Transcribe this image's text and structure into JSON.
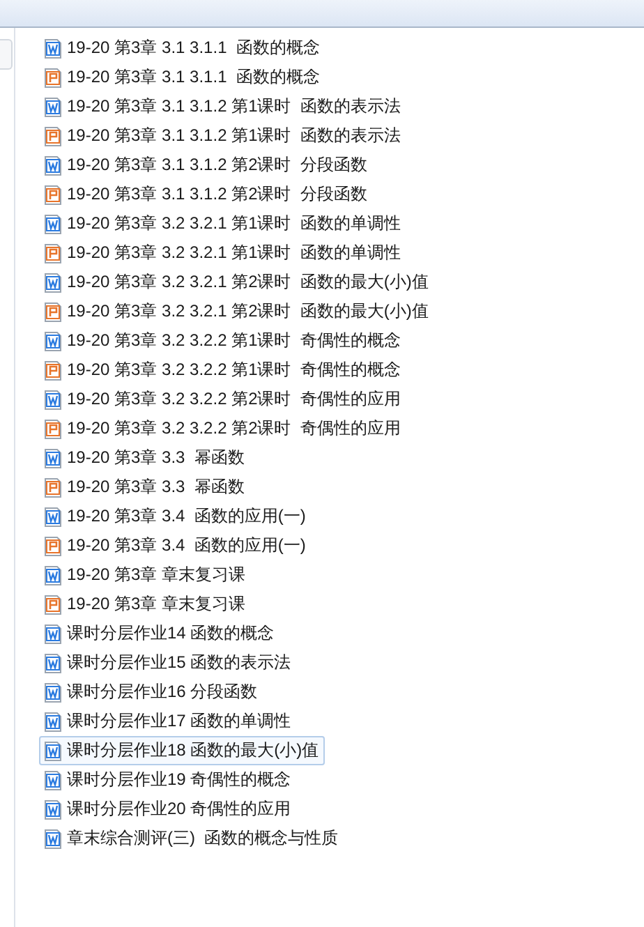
{
  "files": [
    {
      "kind": "word",
      "name": "19-20 第3章 3.1 3.1.1  函数的概念",
      "selected": false
    },
    {
      "kind": "pdf",
      "name": "19-20 第3章 3.1 3.1.1  函数的概念",
      "selected": false
    },
    {
      "kind": "word",
      "name": "19-20 第3章 3.1 3.1.2 第1课时  函数的表示法",
      "selected": false
    },
    {
      "kind": "pdf",
      "name": "19-20 第3章 3.1 3.1.2 第1课时  函数的表示法",
      "selected": false
    },
    {
      "kind": "word",
      "name": "19-20 第3章 3.1 3.1.2 第2课时  分段函数",
      "selected": false
    },
    {
      "kind": "pdf",
      "name": "19-20 第3章 3.1 3.1.2 第2课时  分段函数",
      "selected": false
    },
    {
      "kind": "word",
      "name": "19-20 第3章 3.2 3.2.1 第1课时  函数的单调性",
      "selected": false
    },
    {
      "kind": "pdf",
      "name": "19-20 第3章 3.2 3.2.1 第1课时  函数的单调性",
      "selected": false
    },
    {
      "kind": "word",
      "name": "19-20 第3章 3.2 3.2.1 第2课时  函数的最大(小)值",
      "selected": false
    },
    {
      "kind": "pdf",
      "name": "19-20 第3章 3.2 3.2.1 第2课时  函数的最大(小)值",
      "selected": false
    },
    {
      "kind": "word",
      "name": "19-20 第3章 3.2 3.2.2 第1课时  奇偶性的概念",
      "selected": false
    },
    {
      "kind": "pdf",
      "name": "19-20 第3章 3.2 3.2.2 第1课时  奇偶性的概念",
      "selected": false
    },
    {
      "kind": "word",
      "name": "19-20 第3章 3.2 3.2.2 第2课时  奇偶性的应用",
      "selected": false
    },
    {
      "kind": "pdf",
      "name": "19-20 第3章 3.2 3.2.2 第2课时  奇偶性的应用",
      "selected": false
    },
    {
      "kind": "word",
      "name": "19-20 第3章 3.3  幂函数",
      "selected": false
    },
    {
      "kind": "pdf",
      "name": "19-20 第3章 3.3  幂函数",
      "selected": false
    },
    {
      "kind": "word",
      "name": "19-20 第3章 3.4  函数的应用(一)",
      "selected": false
    },
    {
      "kind": "pdf",
      "name": "19-20 第3章 3.4  函数的应用(一)",
      "selected": false
    },
    {
      "kind": "word",
      "name": "19-20 第3章 章末复习课",
      "selected": false
    },
    {
      "kind": "pdf",
      "name": "19-20 第3章 章末复习课",
      "selected": false
    },
    {
      "kind": "word",
      "name": "课时分层作业14 函数的概念",
      "selected": false
    },
    {
      "kind": "word",
      "name": "课时分层作业15 函数的表示法",
      "selected": false
    },
    {
      "kind": "word",
      "name": "课时分层作业16 分段函数",
      "selected": false
    },
    {
      "kind": "word",
      "name": "课时分层作业17 函数的单调性",
      "selected": false
    },
    {
      "kind": "word",
      "name": "课时分层作业18 函数的最大(小)值",
      "selected": true
    },
    {
      "kind": "word",
      "name": "课时分层作业19 奇偶性的概念",
      "selected": false
    },
    {
      "kind": "word",
      "name": "课时分层作业20 奇偶性的应用",
      "selected": false
    },
    {
      "kind": "word",
      "name": "章末综合测评(三)  函数的概念与性质",
      "selected": false
    }
  ]
}
